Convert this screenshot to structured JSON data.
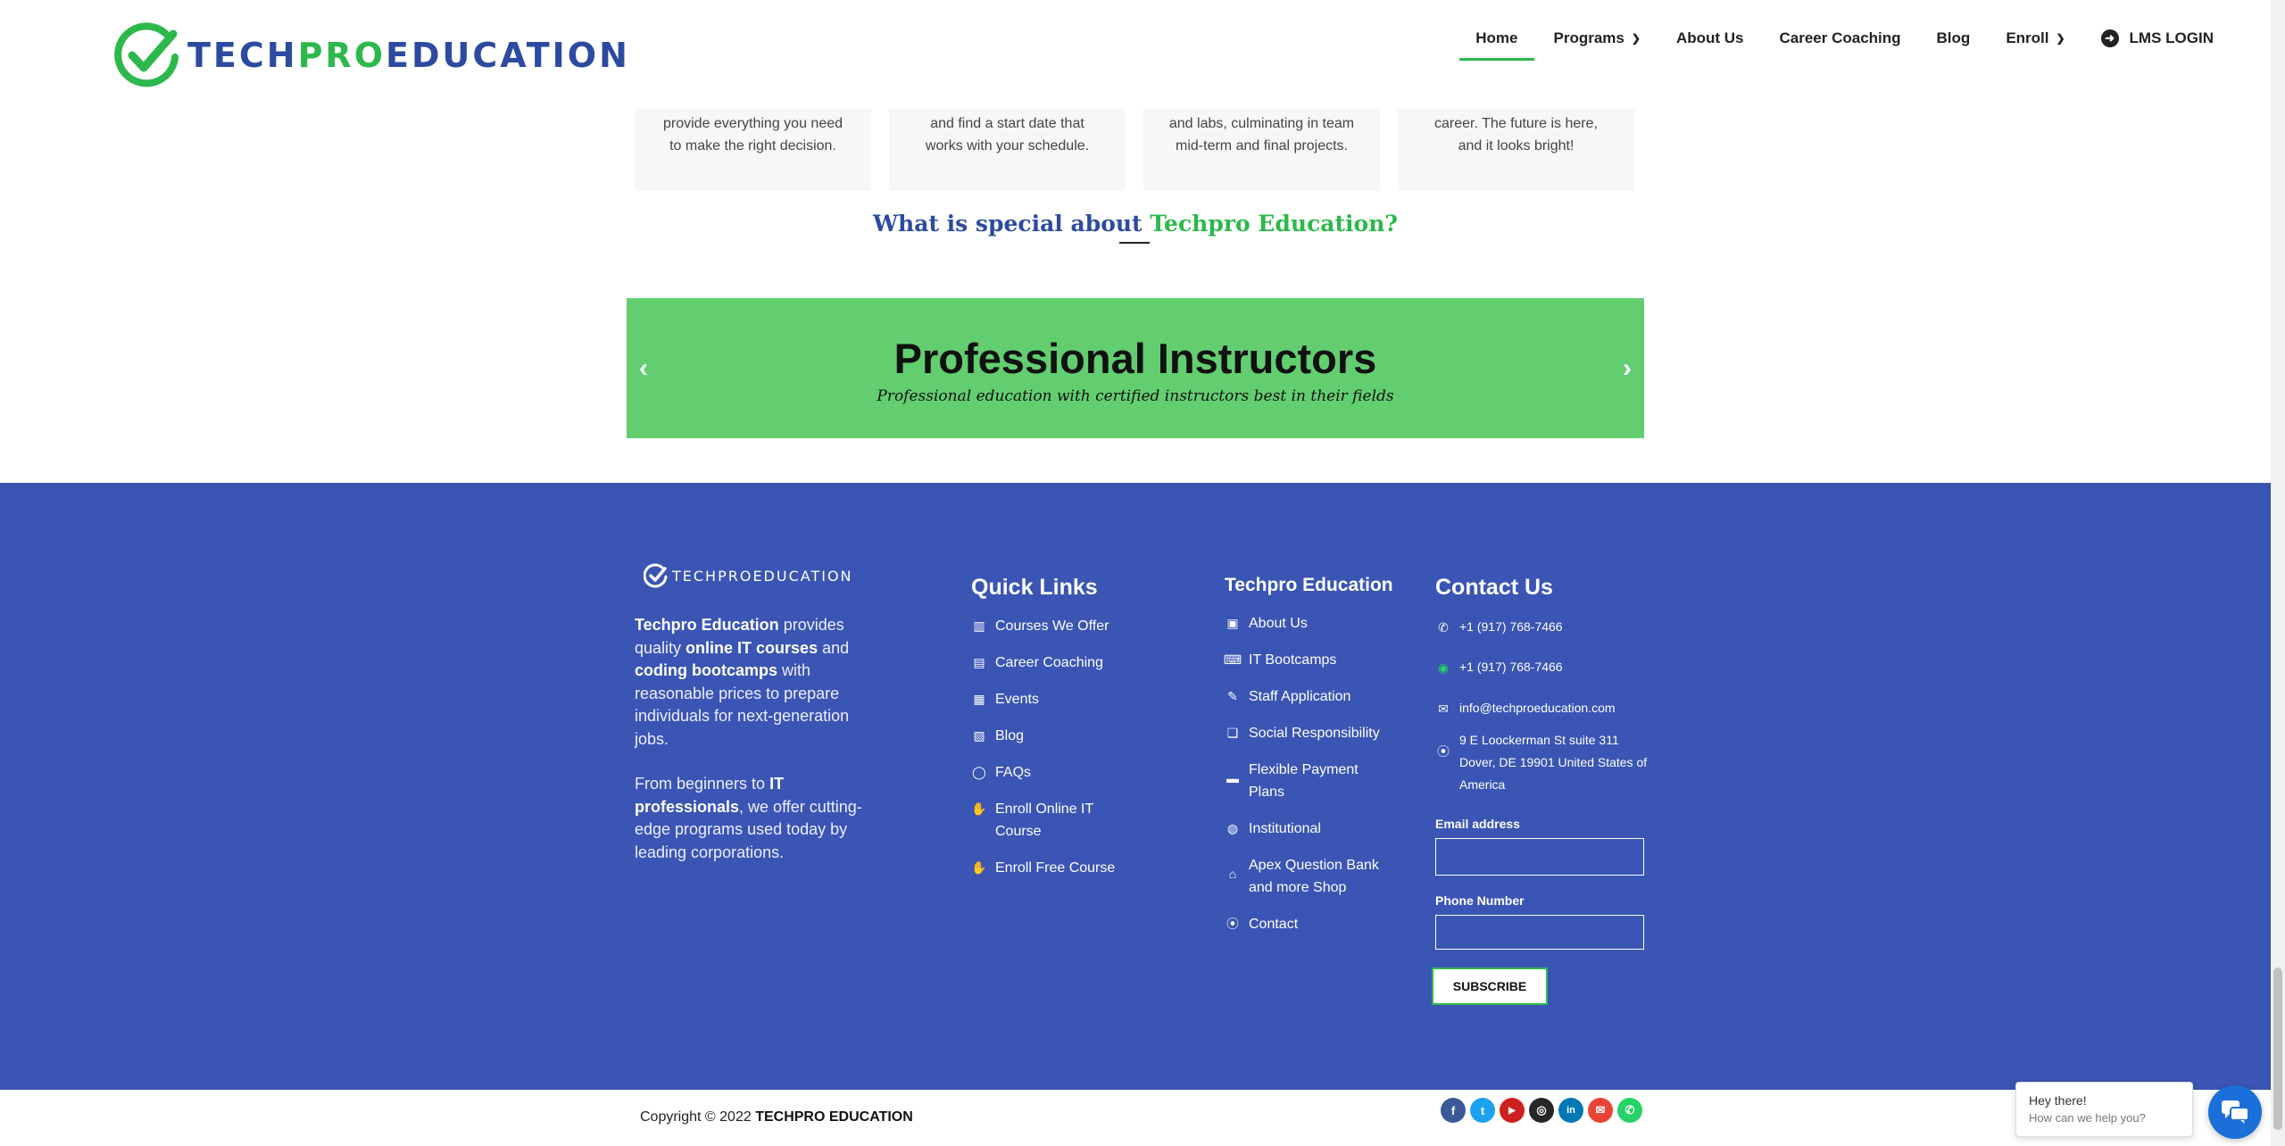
{
  "header": {
    "logo": {
      "part1": "TECH",
      "part2": "PRO",
      "part3": "EDUCATION"
    },
    "nav": [
      {
        "label": "Home",
        "active": true
      },
      {
        "label": "Programs",
        "dropdown": true
      },
      {
        "label": "About Us"
      },
      {
        "label": "Career Coaching"
      },
      {
        "label": "Blog"
      },
      {
        "label": "Enroll",
        "dropdown": true
      }
    ],
    "lms_label": "LMS LOGIN"
  },
  "cards": [
    {
      "line1": "provide everything you need",
      "line2": "to make the right decision."
    },
    {
      "line1": "and find a start date that",
      "line2": "works with your schedule."
    },
    {
      "line1": "and labs, culminating in team",
      "line2": "mid-term and final projects."
    },
    {
      "line1": "career. The future is here,",
      "line2": "and it looks bright!"
    }
  ],
  "special": {
    "part1": "What is special about ",
    "part2": "Techpro Education?"
  },
  "slider": {
    "title": "Professional Instructors",
    "subtitle": "Professional education with certified instructors best in their fields",
    "prev": "‹",
    "next": "›",
    "bg_color": "#62ce70"
  },
  "footer": {
    "logo_text": "TECHPROEDUCATION",
    "about": {
      "p1_b1": "Techpro Education",
      "p1_t1": " provides quality ",
      "p1_b2": "online IT courses",
      "p1_t2": " and ",
      "p1_b3": "coding bootcamps",
      "p1_t3": "  with reasonable prices to prepare individuals for next-generation jobs.",
      "p2_t1": "From beginners to ",
      "p2_b1": "IT professionals",
      "p2_t2": ", we offer cutting-edge programs used today by leading corporations."
    },
    "quick_links": {
      "title": "Quick Links",
      "items": [
        "Courses We Offer",
        "Career Coaching",
        "Events",
        "Blog",
        "FAQs",
        "Enroll Online IT Course",
        "Enroll Free Course"
      ]
    },
    "techpro": {
      "title": "Techpro Education",
      "items": [
        "About Us",
        "IT Bootcamps",
        "Staff Application",
        "Social Responsibility",
        "Flexible Payment Plans",
        "Institutional",
        "Apex Question Bank and more Shop",
        "Contact"
      ]
    },
    "contact": {
      "title": "Contact Us",
      "phone": "+1 (917) 768-7466",
      "whatsapp": "+1 (917) 768-7466",
      "email": "info@techproeducation.com",
      "address": "9 E Loockerman St suite 311 Dover, DE 19901 United States of America"
    },
    "form": {
      "email_label": "Email address",
      "phone_label": "Phone Number",
      "subscribe": "SUBSCRIBE"
    },
    "bg_color": "#3a55b3"
  },
  "bottom": {
    "copyright_prefix": "Copyright © 2022 ",
    "copyright_brand": "TECHPRO EDUCATION",
    "socials": [
      {
        "name": "facebook-icon",
        "glyph": "f",
        "color": "#3b5998"
      },
      {
        "name": "twitter-icon",
        "glyph": "t",
        "color": "#1da1f2"
      },
      {
        "name": "youtube-icon",
        "glyph": "▶",
        "color": "#cd201f"
      },
      {
        "name": "instagram-icon",
        "glyph": "◎",
        "color": "#262626"
      },
      {
        "name": "linkedin-icon",
        "glyph": "in",
        "color": "#0077b5"
      },
      {
        "name": "envelope-icon",
        "glyph": "✉",
        "color": "#ea4335"
      },
      {
        "name": "whatsapp-icon",
        "glyph": "✆",
        "color": "#25d366"
      }
    ]
  },
  "chat": {
    "greeting": "Hey there!",
    "help": "How can we help you?"
  }
}
